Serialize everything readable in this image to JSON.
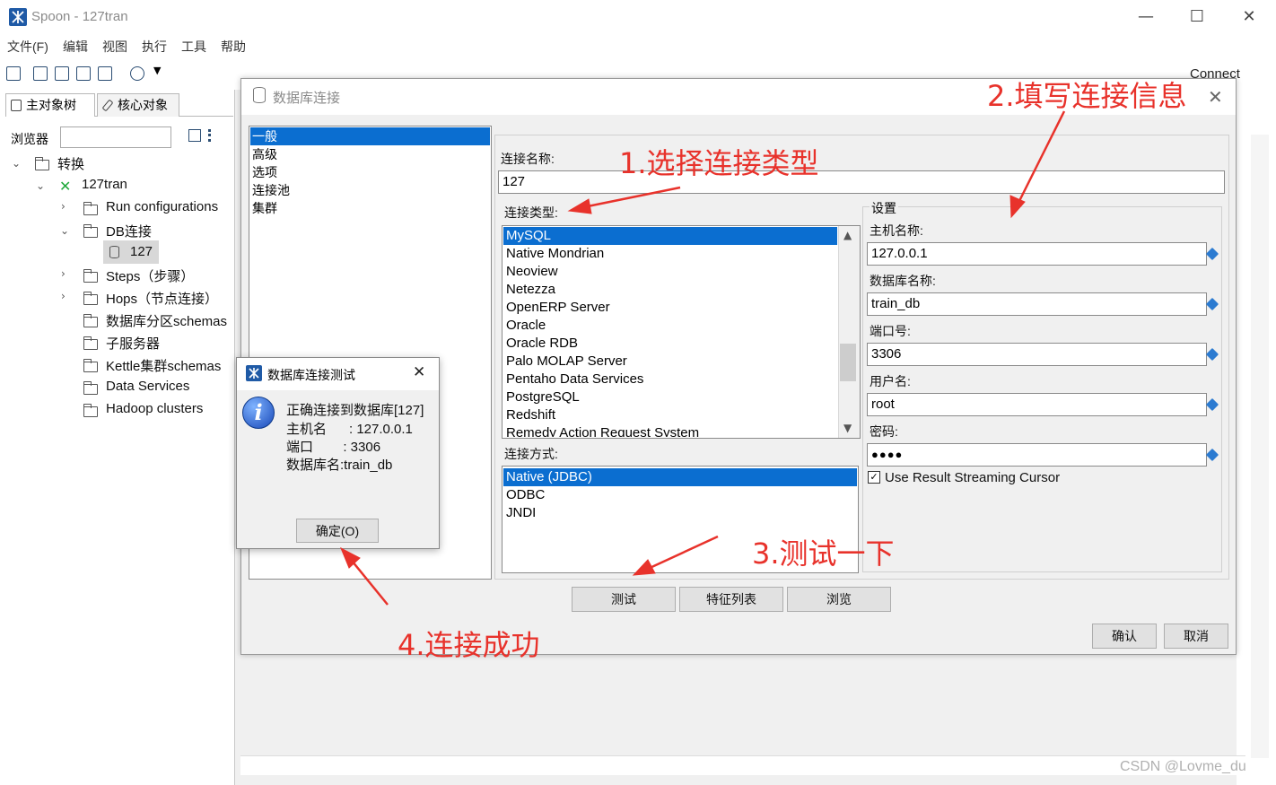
{
  "window": {
    "title": "Spoon - 127tran",
    "minimize": "—",
    "maximize": "☐",
    "close": "✕"
  },
  "menu": [
    "文件(F)",
    "编辑",
    "视图",
    "执行",
    "工具",
    "帮助"
  ],
  "toolbar": {
    "connect": "Connect"
  },
  "left_panel": {
    "tabs": [
      "主对象树",
      "核心对象"
    ],
    "browser_label": "浏览器",
    "browser_value": "",
    "tree": {
      "root": "转换",
      "transformation": "127tran",
      "items": [
        "Run configurations",
        "DB连接",
        "127",
        "Steps（步骤）",
        "Hops（节点连接）",
        "数据库分区schemas",
        "子服务器",
        "Kettle集群schemas",
        "Data Services",
        "Hadoop clusters"
      ]
    }
  },
  "db_dialog": {
    "title": "数据库连接",
    "close": "✕",
    "categories": [
      "一般",
      "高级",
      "选项",
      "连接池",
      "集群"
    ],
    "connection_name_label": "连接名称:",
    "connection_name": "127",
    "connection_type_label": "连接类型:",
    "connection_types": [
      "MySQL",
      "Native Mondrian",
      "Neoview",
      "Netezza",
      "OpenERP Server",
      "Oracle",
      "Oracle RDB",
      "Palo MOLAP Server",
      "Pentaho Data Services",
      "PostgreSQL",
      "Redshift",
      "Remedy Action Request System"
    ],
    "access_label": "连接方式:",
    "access_methods": [
      "Native (JDBC)",
      "ODBC",
      "JNDI"
    ],
    "settings_label": "设置",
    "host_label": "主机名称:",
    "host": "127.0.0.1",
    "dbname_label": "数据库名称:",
    "dbname": "train_db",
    "port_label": "端口号:",
    "port": "3306",
    "user_label": "用户名:",
    "user": "root",
    "password_label": "密码:",
    "password": "●●●●",
    "streaming_label": "Use Result Streaming Cursor",
    "streaming_checked": "✓",
    "buttons": {
      "test": "测试",
      "features": "特征列表",
      "explore": "浏览",
      "ok": "确认",
      "cancel": "取消"
    }
  },
  "test_dialog": {
    "title": "数据库连接测试",
    "close": "✕",
    "icon": "i",
    "lines": [
      "正确连接到数据库[127]",
      "主机名      : 127.0.0.1",
      "端口        : 3306",
      "数据库名:train_db"
    ],
    "ok": "确定(O)"
  },
  "annotations": [
    "1.选择连接类型",
    "2.填写连接信息",
    "3.测试一下",
    "4.连接成功"
  ],
  "watermark": "CSDN @Lovme_du",
  "colors": {
    "selection": "#0b6ed0",
    "annotation": "#e8322b",
    "accent": "#2c7bd1"
  }
}
